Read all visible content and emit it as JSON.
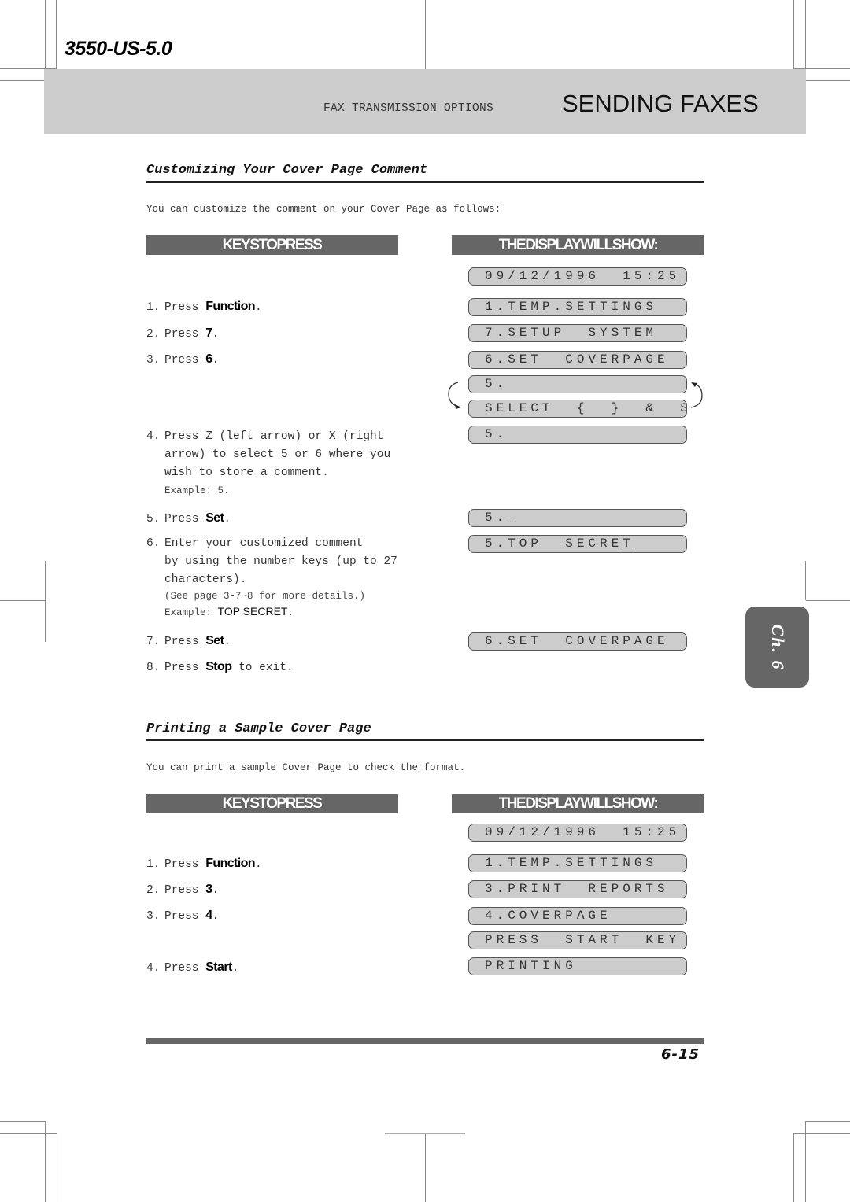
{
  "header": {
    "model_id": "3550-US-5.0",
    "section_label": "FAX TRANSMISSION OPTIONS",
    "chapter_title": "SENDING FAXES"
  },
  "chapter_tab": "Ch. 6",
  "sections": [
    {
      "title": "Customizing Your Cover Page Comment",
      "intro": "You can customize the comment on your Cover Page as follows:",
      "keys_header": "KEYSTOPRESS",
      "display_header": "THEDISPLAYWILLSHOW:",
      "steps": [
        {
          "num": "1.",
          "text": "Press ",
          "key": "Function",
          "end": "."
        },
        {
          "num": "2.",
          "text": "Press ",
          "key": "7",
          "end": "."
        },
        {
          "num": "3.",
          "text": "Press ",
          "key": "6",
          "end": "."
        },
        {
          "num": "4.",
          "lines": [
            "Press Z (left arrow) or X (right",
            "arrow) to select 5 or 6 where you",
            "wish to store a comment."
          ],
          "example": "Example: 5."
        },
        {
          "num": "5.",
          "text": "Press ",
          "key": "Set",
          "end": "."
        },
        {
          "num": "6.",
          "lines": [
            "Enter your customized comment",
            "by using the number keys (up to 27",
            "characters)."
          ],
          "note": "(See page 3-7~8 for more details.)",
          "example_label": "Example: ",
          "example_value": "TOP SECRET",
          "example_end": "."
        },
        {
          "num": "7.",
          "text": "Press ",
          "key": "Set",
          "end": "."
        },
        {
          "num": "8.",
          "text": "Press ",
          "key": "Stop",
          "end": " to exit."
        }
      ],
      "display": [
        "09/12/1996  15:25",
        "1.TEMP.SETTINGS",
        "7.SETUP  SYSTEM",
        "6.SET  COVERPAGE",
        "5.",
        "SELECT  {  }  &  SET",
        "5.",
        "5._",
        "5.TOP  SECRE",
        "6.SET  COVERPAGE"
      ],
      "display_cursor_char": "T"
    },
    {
      "title": "Printing a Sample Cover Page",
      "intro": "You can print a sample Cover Page to check the format.",
      "keys_header": "KEYSTOPRESS",
      "display_header": "THEDISPLAYWILLSHOW:",
      "steps": [
        {
          "num": "1.",
          "text": "Press ",
          "key": "Function",
          "end": "."
        },
        {
          "num": "2.",
          "text": "Press ",
          "key": "3",
          "end": "."
        },
        {
          "num": "3.",
          "text": "Press ",
          "key": "4",
          "end": "."
        },
        {
          "num": "4.",
          "text": "Press ",
          "key": "Start",
          "end": "."
        }
      ],
      "display": [
        "09/12/1996  15:25",
        "1.TEMP.SETTINGS",
        "3.PRINT  REPORTS",
        "4.COVERPAGE",
        "PRESS  START  KEY",
        "PRINTING"
      ]
    }
  ],
  "footer": {
    "page_number": "6-15"
  }
}
